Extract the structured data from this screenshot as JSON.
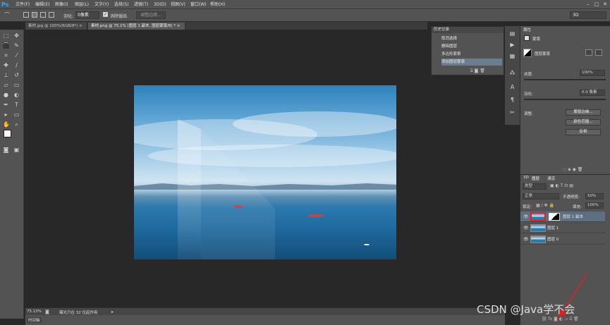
{
  "app_logo": "Ps",
  "menus": [
    "文件(F)",
    "编辑(E)",
    "图像(I)",
    "图层(L)",
    "文字(Y)",
    "选择(S)",
    "滤镜(T)",
    "3D(D)",
    "视图(V)",
    "窗口(W)",
    "帮助(H)"
  ],
  "window_controls": [
    "–",
    "□",
    "✕"
  ],
  "options": {
    "feather_label": "羽化:",
    "feather_value": "0像素",
    "antialias_label": "消除锯齿",
    "refine_edge_label": "调整边缘...",
    "workspace_value": "3D"
  },
  "tabs": [
    "素材.jpg @ 100%(RGB/8*) ×",
    "素材.png @ 75.1% (图层 1 副本, 图层蒙版/8) * ×"
  ],
  "history": {
    "title": "历史记录",
    "items": [
      "取消选择",
      "删除图层",
      "多边形套索",
      "添加图层蒙版"
    ]
  },
  "properties": {
    "tab": "属性",
    "mask_type": "蒙版",
    "layer_mask_label": "图层蒙版",
    "density_label": "浓度:",
    "density_value": "100%",
    "feather_label": "羽化:",
    "feather_value": "0.0 像素",
    "adjust_label": "调整:",
    "mask_edge_btn": "蒙版边缘...",
    "color_range_btn": "颜色范围...",
    "invert_btn": "反相"
  },
  "layers": {
    "tabs": [
      "3D",
      "图层",
      "通道"
    ],
    "kind_filter": "类型",
    "blend_mode": "正常",
    "opacity_label": "不透明度:",
    "opacity_value": "50%",
    "lock_label": "锁定:",
    "fill_label": "填充:",
    "fill_value": "100%",
    "items": [
      {
        "name": "图层 1 副本",
        "selected": true
      },
      {
        "name": "图层 1",
        "selected": false
      },
      {
        "name": "图层 0",
        "selected": false
      }
    ]
  },
  "status": {
    "zoom": "75.13%",
    "info": "曝光只在 32 位起作用"
  },
  "timeline_label": "时间轴",
  "watermark": "CSDN @Java学不会",
  "colors": {
    "accent": "#31a8ff",
    "highlight_box": "#e02020"
  }
}
